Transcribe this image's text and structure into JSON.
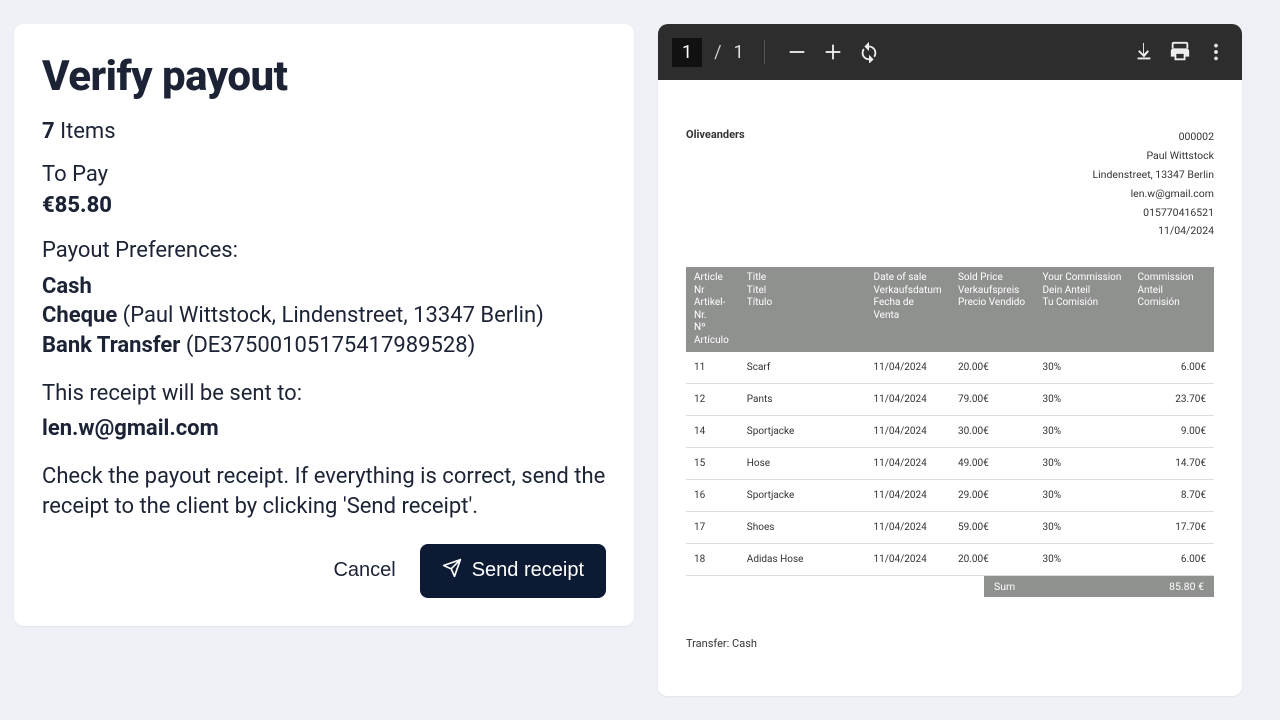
{
  "left": {
    "title": "Verify payout",
    "items_count": "7",
    "items_word": " Items",
    "to_pay_label": "To Pay",
    "to_pay_amount": "€85.80",
    "prefs_label": "Payout Preferences:",
    "pref_cash": "Cash",
    "pref_cheque_label": "Cheque",
    "pref_cheque_detail": " (Paul Wittstock, Lindenstreet, 13347 Berlin)",
    "pref_bank_label": "Bank Transfer",
    "pref_bank_detail": " (DE3750010517541798952­8)",
    "sent_to_label": "This receipt will be sent to:",
    "sent_to_email": "len.w@gmail.com",
    "instruction": "Check the payout receipt. If everything is correct, send the receipt to the client by clicking 'Send receipt'.",
    "cancel": "Cancel",
    "send": "Send receipt"
  },
  "pdf": {
    "page_current": "1",
    "page_total": "1",
    "brand": "Oliveanders",
    "doc_no": "000002",
    "name": "Paul Wittstock",
    "address": "Lindenstreet, 13347 Berlin",
    "email": "len.w@gmail.com",
    "phone": "015770416521",
    "date": "11/04/2024",
    "headers": {
      "article": [
        "Article Nr",
        "Artikel-Nr.",
        "Nº Artículo"
      ],
      "title": [
        "Title",
        "Titel",
        "Título"
      ],
      "date": [
        "Date of sale",
        "Verkaufsdatum",
        "Fecha de Venta"
      ],
      "price": [
        "Sold Price",
        "Verkaufspreis",
        "Precio Vendido"
      ],
      "yourcomm": [
        "Your Commission",
        "Dein Anteil",
        "Tu Comisión"
      ],
      "comm": [
        "Commission",
        "Anteil",
        "Comisión"
      ]
    },
    "rows": [
      {
        "nr": "11",
        "title": "Scarf",
        "date": "11/04/2024",
        "price": "20.00€",
        "pct": "30%",
        "comm": "6.00€"
      },
      {
        "nr": "12",
        "title": "Pants",
        "date": "11/04/2024",
        "price": "79.00€",
        "pct": "30%",
        "comm": "23.70€"
      },
      {
        "nr": "14",
        "title": "Sportjacke",
        "date": "11/04/2024",
        "price": "30.00€",
        "pct": "30%",
        "comm": "9.00€"
      },
      {
        "nr": "15",
        "title": "Hose",
        "date": "11/04/2024",
        "price": "49.00€",
        "pct": "30%",
        "comm": "14.70€"
      },
      {
        "nr": "16",
        "title": "Sportjacke",
        "date": "11/04/2024",
        "price": "29.00€",
        "pct": "30%",
        "comm": "8.70€"
      },
      {
        "nr": "17",
        "title": "Shoes",
        "date": "11/04/2024",
        "price": "59.00€",
        "pct": "30%",
        "comm": "17.70€"
      },
      {
        "nr": "18",
        "title": "Adidas Hose",
        "date": "11/04/2024",
        "price": "20.00€",
        "pct": "30%",
        "comm": "6.00€"
      }
    ],
    "sum_label": "Sum",
    "sum_value": "85.80 €",
    "transfer": "Transfer: Cash"
  }
}
